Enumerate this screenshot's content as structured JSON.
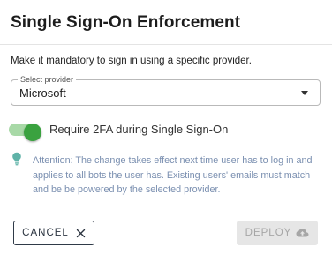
{
  "dialog": {
    "title": "Single Sign-On Enforcement",
    "description": "Make it mandatory to sign in using a specific provider."
  },
  "provider_select": {
    "label": "Select provider",
    "value": "Microsoft"
  },
  "twofa_toggle": {
    "label": "Require 2FA during Single Sign-On",
    "checked": true
  },
  "hint": {
    "icon": "lightbulb-icon",
    "text": "Attention: The change takes effect next time user has to log in and applies to all bots the user has. Existing users' emails must match and be be powered by the selected provider."
  },
  "actions": {
    "cancel_label": "CANCEL",
    "cancel_icon": "close-icon",
    "deploy_label": "DEPLOY",
    "deploy_icon": "cloud-upload-icon",
    "deploy_disabled": true
  },
  "colors": {
    "toggle_on": "#3aa23f",
    "toggle_track": "#a8d9a7",
    "hint_text": "#7a8fb0",
    "hint_icon": "#5fb3a8"
  }
}
